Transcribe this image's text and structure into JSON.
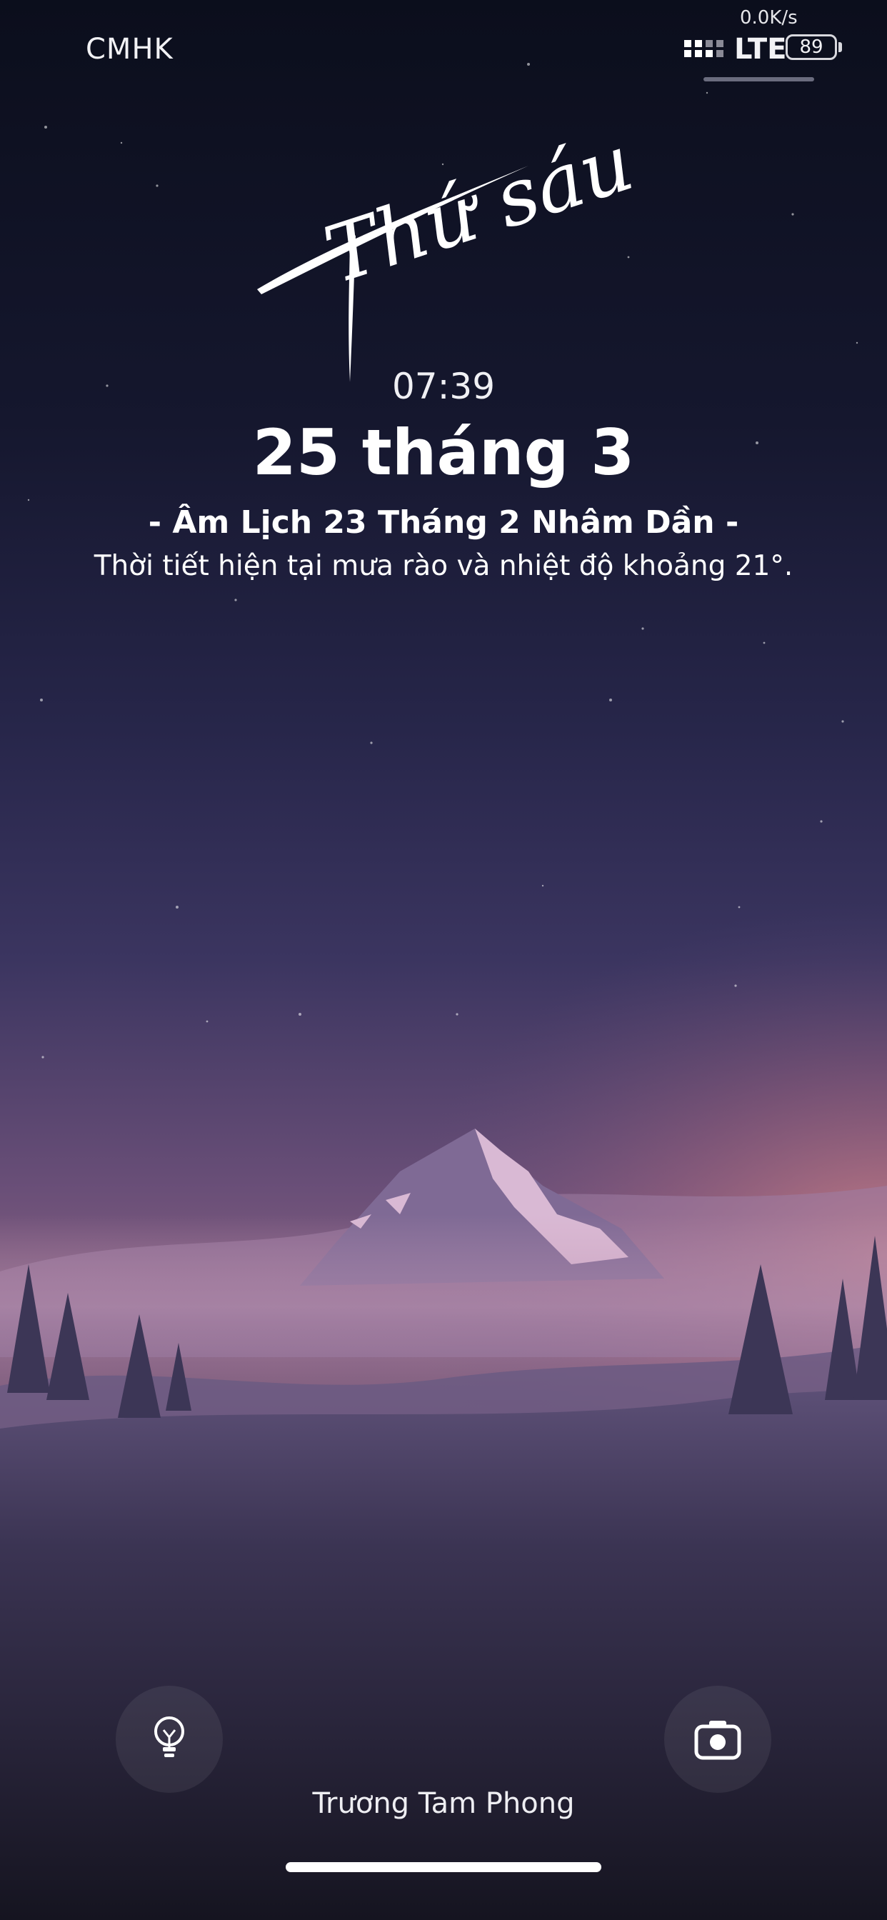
{
  "status_bar": {
    "carrier": "CMHK",
    "net_speed": "0.0K/s",
    "network_type": "LTE",
    "battery_level": "89"
  },
  "lock_screen": {
    "weekday": "Thứ sáu",
    "time": "07:39",
    "date": "25 tháng 3",
    "lunar_date": "- Âm Lịch 23 Tháng 2 Nhâm Dần -",
    "weather": "Thời tiết hiện tại mưa rào và nhiệt độ khoảng 21°.",
    "owner_name": "Trương Tam Phong"
  },
  "controls": {
    "left_icon": "flashlight-icon",
    "right_icon": "camera-icon"
  },
  "colors": {
    "sky_top": "#0c0f1e",
    "sky_mid": "#2c2a4e",
    "horizon_glow": "#c77d8a",
    "ground": "#1e1c2c"
  }
}
